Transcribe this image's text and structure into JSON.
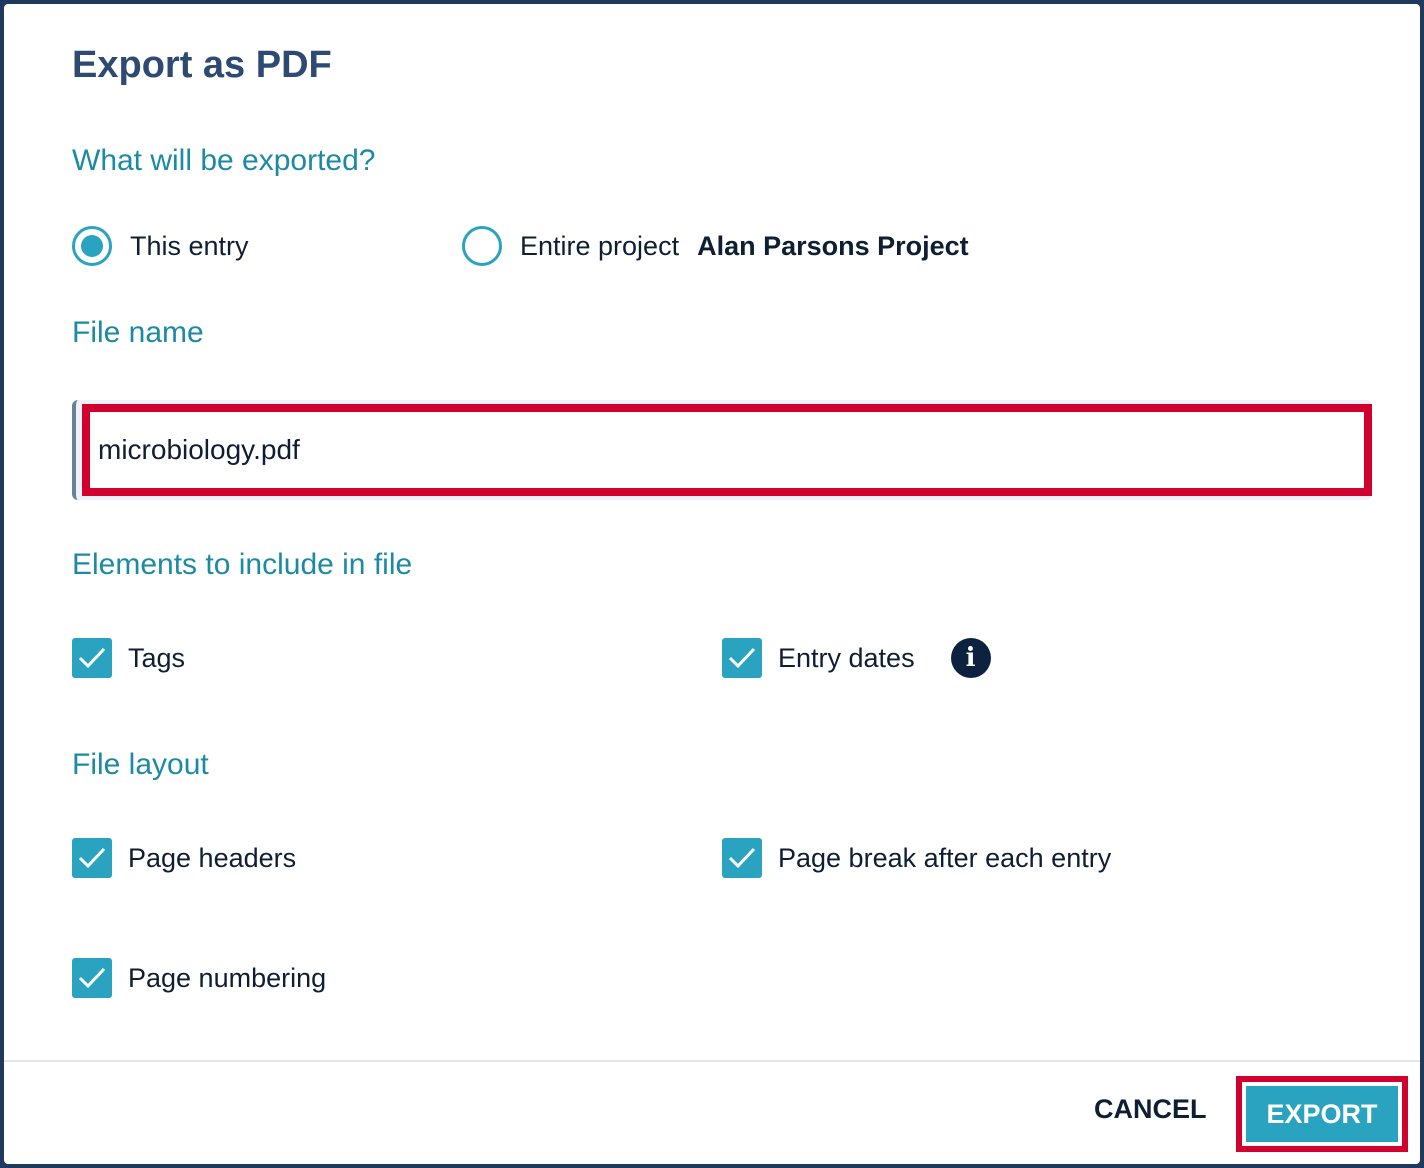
{
  "dialog": {
    "title": "Export as PDF"
  },
  "export_scope": {
    "label": "What will be exported?",
    "options": [
      {
        "label": "This entry",
        "selected": true
      },
      {
        "label": "Entire project",
        "selected": false,
        "project_name": "Alan Parsons Project"
      }
    ]
  },
  "file_name": {
    "label": "File name",
    "value": "microbiology.pdf"
  },
  "elements": {
    "label": "Elements to include in file",
    "items": [
      {
        "label": "Tags",
        "checked": true
      },
      {
        "label": "Entry dates",
        "checked": true,
        "icon": "info-icon"
      }
    ]
  },
  "layout": {
    "label": "File layout",
    "items": [
      {
        "label": "Page headers",
        "checked": true
      },
      {
        "label": "Page break after each entry",
        "checked": true
      },
      {
        "label": "Page numbering",
        "checked": true
      }
    ]
  },
  "footer": {
    "cancel_label": "CANCEL",
    "export_label": "EXPORT"
  },
  "colors": {
    "accent": "#2aa3c0",
    "title": "#2e4a72",
    "highlight": "#d0002f"
  }
}
